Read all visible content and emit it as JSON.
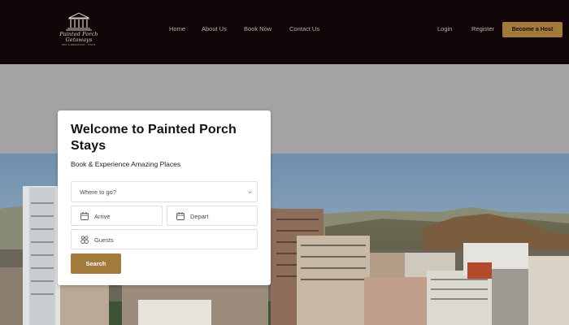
{
  "brand": {
    "logo_script": "Painted Porch Getaways",
    "logo_tag": "BED & BREAKFAST · STAYS"
  },
  "nav": {
    "items": [
      {
        "label": "Home"
      },
      {
        "label": "About Us"
      },
      {
        "label": "Book Now"
      },
      {
        "label": "Contact Us"
      }
    ],
    "login": "Login",
    "register": "Register",
    "become_host": "Become a Host"
  },
  "booking": {
    "title": "Welcome to Painted Porch Stays",
    "subtitle": "Book & Experience Amazing Places",
    "where_placeholder": "Where to go?",
    "arrive_placeholder": "Arrive",
    "depart_placeholder": "Depart",
    "guests_placeholder": "Guests",
    "search_label": "Search"
  },
  "colors": {
    "header_bg": "#110608",
    "accent": "#a27a3b",
    "sky": "#7c98b3"
  },
  "icons": {
    "logo": "pillar-building-icon",
    "where": "chevron-down-icon",
    "arrive": "calendar-icon",
    "depart": "calendar-icon",
    "guests": "guests-icon"
  }
}
